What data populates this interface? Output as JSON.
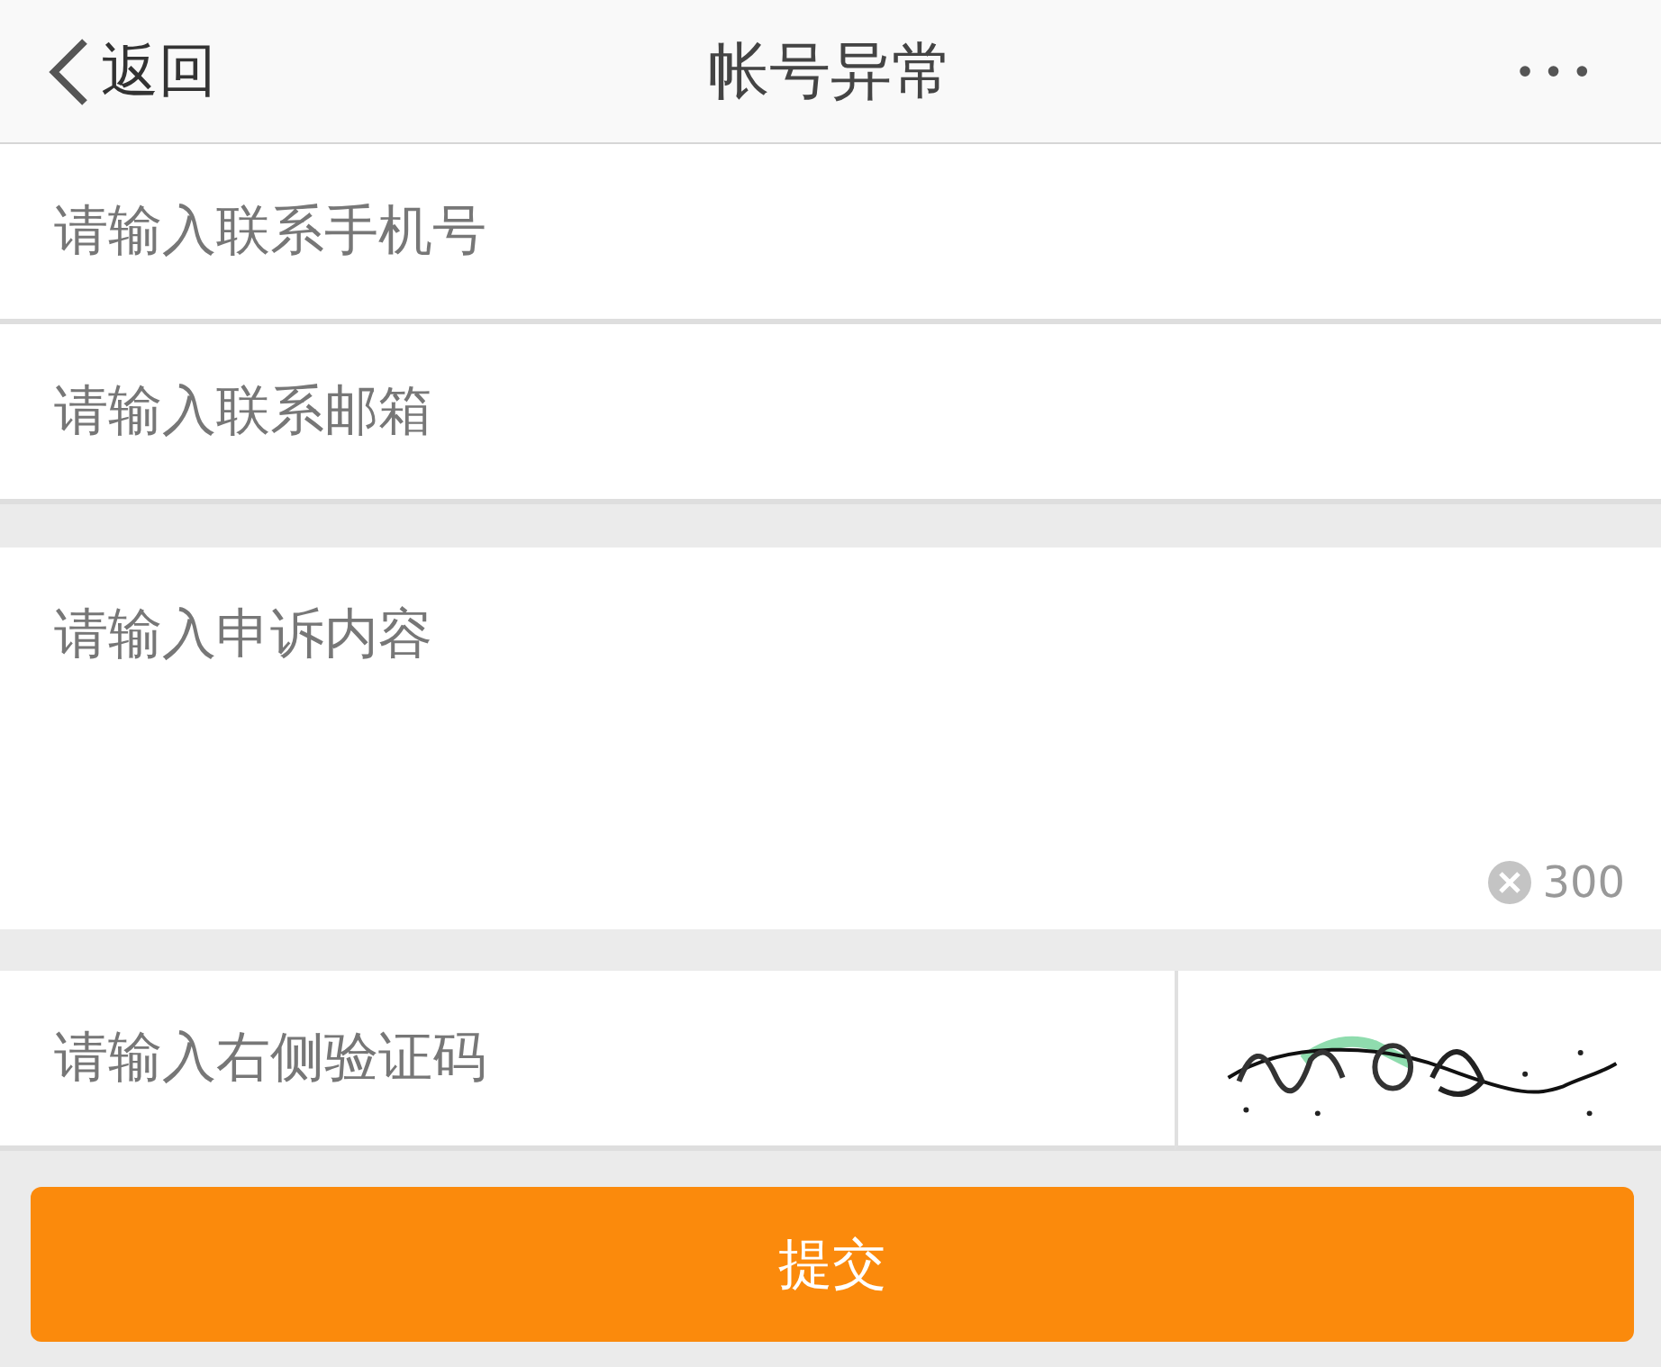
{
  "header": {
    "back_label": "返回",
    "title": "帐号异常",
    "more": "•••"
  },
  "fields": [
    {
      "placeholder": "请输入联系手机号"
    },
    {
      "placeholder": "请输入联系邮箱"
    }
  ],
  "appeal": {
    "placeholder": "请输入申诉内容",
    "counter": "300"
  },
  "captcha": {
    "placeholder": "请输入右侧验证码"
  },
  "submit": "提交"
}
